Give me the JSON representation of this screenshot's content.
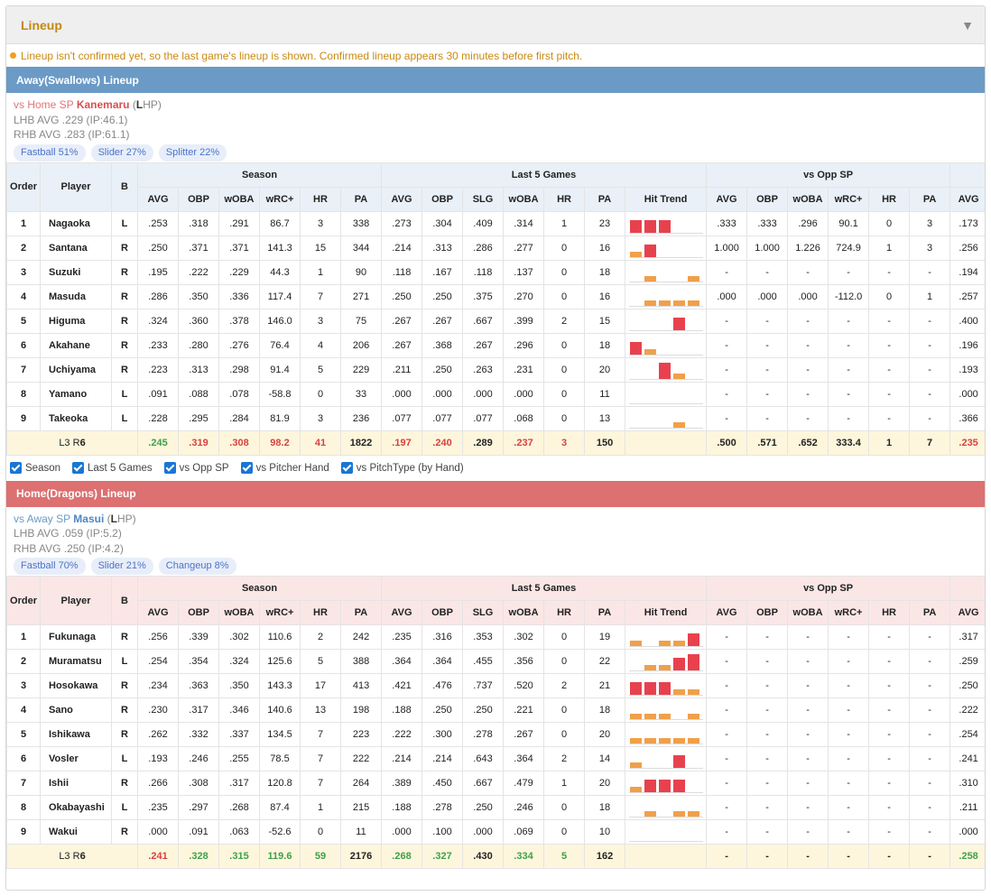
{
  "panel": {
    "title": "Lineup",
    "notice": "Lineup isn't confirmed yet, so the last game's lineup is shown. Confirmed lineup appears 30 minutes before first pitch."
  },
  "headers": {
    "order": "Order",
    "player": "Player",
    "bats": "B",
    "groups": [
      "Season",
      "Last 5 Games",
      "vs Opp SP"
    ],
    "season": [
      "AVG",
      "OBP",
      "wOBA",
      "wRC+",
      "HR",
      "PA"
    ],
    "last5": [
      "AVG",
      "OBP",
      "SLG",
      "wOBA",
      "HR",
      "PA",
      "Hit Trend"
    ],
    "opp": [
      "AVG",
      "OBP",
      "wOBA",
      "wRC+",
      "HR",
      "PA"
    ],
    "extra": "AVG"
  },
  "options": [
    "Season",
    "Last 5 Games",
    "vs Opp SP",
    "vs Pitcher Hand",
    "vs PitchType (by Hand)"
  ],
  "colors": {
    "away_bar": "#6b9ac6",
    "home_bar": "#dd7070",
    "trend_hit": "#e8414e",
    "trend_out": "#f0a04a",
    "summary_bg": "#fdf6dc"
  },
  "away": {
    "title": "Away(Swallows) Lineup",
    "sp_prefix": "vs Home SP",
    "sp_name": "Kanemaru",
    "sp_hand_open": "(",
    "sp_hand_letter": "L",
    "sp_hand_rest": "HP)",
    "lhb": "LHB AVG .229 (IP:46.1)",
    "rhb": "RHB AVG .283 (IP:61.1)",
    "pitches": [
      "Fastball 51%",
      "Slider 27%",
      "Splitter 22%"
    ],
    "rows": [
      {
        "o": "1",
        "n": "Nagaoka",
        "b": "L",
        "s": [
          ".253",
          ".318",
          ".291",
          "86.7",
          "3",
          "338"
        ],
        "l": [
          ".273",
          ".304",
          ".409",
          ".314",
          "1",
          "23"
        ],
        "t": [
          3,
          3,
          3,
          0,
          0
        ],
        "p": [
          ".333",
          ".333",
          ".296",
          "90.1",
          "0",
          "3"
        ],
        "x": ".173"
      },
      {
        "o": "2",
        "n": "Santana",
        "b": "R",
        "s": [
          ".250",
          ".371",
          ".371",
          "141.3",
          "15",
          "344"
        ],
        "l": [
          ".214",
          ".313",
          ".286",
          ".277",
          "0",
          "16"
        ],
        "t": [
          1,
          3,
          0,
          0,
          0
        ],
        "p": [
          "1.000",
          "1.000",
          "1.226",
          "724.9",
          "1",
          "3"
        ],
        "x": ".256"
      },
      {
        "o": "3",
        "n": "Suzuki",
        "b": "R",
        "s": [
          ".195",
          ".222",
          ".229",
          "44.3",
          "1",
          "90"
        ],
        "l": [
          ".118",
          ".167",
          ".118",
          ".137",
          "0",
          "18"
        ],
        "t": [
          0,
          1,
          0,
          0,
          1
        ],
        "p": [
          "-",
          "-",
          "-",
          "-",
          "-",
          "-"
        ],
        "x": ".194"
      },
      {
        "o": "4",
        "n": "Masuda",
        "b": "R",
        "s": [
          ".286",
          ".350",
          ".336",
          "117.4",
          "7",
          "271"
        ],
        "l": [
          ".250",
          ".250",
          ".375",
          ".270",
          "0",
          "16"
        ],
        "t": [
          0,
          1,
          1,
          1,
          1
        ],
        "p": [
          ".000",
          ".000",
          ".000",
          "-112.0",
          "0",
          "1"
        ],
        "x": ".257"
      },
      {
        "o": "5",
        "n": "Higuma",
        "b": "R",
        "s": [
          ".324",
          ".360",
          ".378",
          "146.0",
          "3",
          "75"
        ],
        "l": [
          ".267",
          ".267",
          ".667",
          ".399",
          "2",
          "15"
        ],
        "t": [
          0,
          0,
          0,
          3,
          0
        ],
        "p": [
          "-",
          "-",
          "-",
          "-",
          "-",
          "-"
        ],
        "x": ".400"
      },
      {
        "o": "6",
        "n": "Akahane",
        "b": "R",
        "s": [
          ".233",
          ".280",
          ".276",
          "76.4",
          "4",
          "206"
        ],
        "l": [
          ".267",
          ".368",
          ".267",
          ".296",
          "0",
          "18"
        ],
        "t": [
          3,
          1,
          0,
          0,
          0
        ],
        "p": [
          "-",
          "-",
          "-",
          "-",
          "-",
          "-"
        ],
        "x": ".196"
      },
      {
        "o": "7",
        "n": "Uchiyama",
        "b": "R",
        "s": [
          ".223",
          ".313",
          ".298",
          "91.4",
          "5",
          "229"
        ],
        "l": [
          ".211",
          ".250",
          ".263",
          ".231",
          "0",
          "20"
        ],
        "t": [
          0,
          0,
          4,
          1,
          0
        ],
        "p": [
          "-",
          "-",
          "-",
          "-",
          "-",
          "-"
        ],
        "x": ".193"
      },
      {
        "o": "8",
        "n": "Yamano",
        "b": "L",
        "s": [
          ".091",
          ".088",
          ".078",
          "-58.8",
          "0",
          "33"
        ],
        "l": [
          ".000",
          ".000",
          ".000",
          ".000",
          "0",
          "11"
        ],
        "t": [
          0,
          0,
          0,
          0,
          0
        ],
        "p": [
          "-",
          "-",
          "-",
          "-",
          "-",
          "-"
        ],
        "x": ".000"
      },
      {
        "o": "9",
        "n": "Takeoka",
        "b": "L",
        "s": [
          ".228",
          ".295",
          ".284",
          "81.9",
          "3",
          "236"
        ],
        "l": [
          ".077",
          ".077",
          ".077",
          ".068",
          "0",
          "13"
        ],
        "t": [
          0,
          0,
          0,
          1,
          0
        ],
        "p": [
          "-",
          "-",
          "-",
          "-",
          "-",
          "-"
        ],
        "x": ".366"
      }
    ],
    "summary": {
      "label": "L3 R",
      "label_b": "6",
      "s": [
        ".245",
        ".319",
        ".308",
        "98.2",
        "41",
        "1822"
      ],
      "sc": [
        "grn",
        "red",
        "red",
        "red",
        "red",
        ""
      ],
      "l": [
        ".197",
        ".240",
        ".289",
        ".237",
        "3",
        "150"
      ],
      "lc": [
        "red",
        "red",
        "",
        "red",
        "red",
        ""
      ],
      "p": [
        ".500",
        ".571",
        ".652",
        "333.4",
        "1",
        "7"
      ],
      "x": ".235",
      "xc": "red"
    }
  },
  "home": {
    "title": "Home(Dragons) Lineup",
    "sp_prefix": "vs Away SP",
    "sp_name": "Masui",
    "sp_hand_open": "(",
    "sp_hand_letter": "L",
    "sp_hand_rest": "HP)",
    "lhb": "LHB AVG .059 (IP:5.2)",
    "rhb": "RHB AVG .250 (IP:4.2)",
    "pitches": [
      "Fastball 70%",
      "Slider 21%",
      "Changeup 8%"
    ],
    "rows": [
      {
        "o": "1",
        "n": "Fukunaga",
        "b": "R",
        "s": [
          ".256",
          ".339",
          ".302",
          "110.6",
          "2",
          "242"
        ],
        "l": [
          ".235",
          ".316",
          ".353",
          ".302",
          "0",
          "19"
        ],
        "t": [
          1,
          0,
          1,
          1,
          3
        ],
        "p": [
          "-",
          "-",
          "-",
          "-",
          "-",
          "-"
        ],
        "x": ".317"
      },
      {
        "o": "2",
        "n": "Muramatsu",
        "b": "L",
        "s": [
          ".254",
          ".354",
          ".324",
          "125.6",
          "5",
          "388"
        ],
        "l": [
          ".364",
          ".364",
          ".455",
          ".356",
          "0",
          "22"
        ],
        "t": [
          0,
          1,
          1,
          3,
          4
        ],
        "p": [
          "-",
          "-",
          "-",
          "-",
          "-",
          "-"
        ],
        "x": ".259"
      },
      {
        "o": "3",
        "n": "Hosokawa",
        "b": "R",
        "s": [
          ".234",
          ".363",
          ".350",
          "143.3",
          "17",
          "413"
        ],
        "l": [
          ".421",
          ".476",
          ".737",
          ".520",
          "2",
          "21"
        ],
        "t": [
          3,
          3,
          3,
          1,
          1
        ],
        "p": [
          "-",
          "-",
          "-",
          "-",
          "-",
          "-"
        ],
        "x": ".250"
      },
      {
        "o": "4",
        "n": "Sano",
        "b": "R",
        "s": [
          ".230",
          ".317",
          ".346",
          "140.6",
          "13",
          "198"
        ],
        "l": [
          ".188",
          ".250",
          ".250",
          ".221",
          "0",
          "18"
        ],
        "t": [
          1,
          1,
          1,
          0,
          1
        ],
        "p": [
          "-",
          "-",
          "-",
          "-",
          "-",
          "-"
        ],
        "x": ".222"
      },
      {
        "o": "5",
        "n": "Ishikawa",
        "b": "R",
        "s": [
          ".262",
          ".332",
          ".337",
          "134.5",
          "7",
          "223"
        ],
        "l": [
          ".222",
          ".300",
          ".278",
          ".267",
          "0",
          "20"
        ],
        "t": [
          1,
          1,
          1,
          1,
          1
        ],
        "p": [
          "-",
          "-",
          "-",
          "-",
          "-",
          "-"
        ],
        "x": ".254"
      },
      {
        "o": "6",
        "n": "Vosler",
        "b": "L",
        "s": [
          ".193",
          ".246",
          ".255",
          "78.5",
          "7",
          "222"
        ],
        "l": [
          ".214",
          ".214",
          ".643",
          ".364",
          "2",
          "14"
        ],
        "t": [
          1,
          0,
          0,
          3,
          0
        ],
        "p": [
          "-",
          "-",
          "-",
          "-",
          "-",
          "-"
        ],
        "x": ".241"
      },
      {
        "o": "7",
        "n": "Ishii",
        "b": "R",
        "s": [
          ".266",
          ".308",
          ".317",
          "120.8",
          "7",
          "264"
        ],
        "l": [
          ".389",
          ".450",
          ".667",
          ".479",
          "1",
          "20"
        ],
        "t": [
          1,
          3,
          3,
          3,
          0
        ],
        "p": [
          "-",
          "-",
          "-",
          "-",
          "-",
          "-"
        ],
        "x": ".310"
      },
      {
        "o": "8",
        "n": "Okabayashi",
        "b": "L",
        "s": [
          ".235",
          ".297",
          ".268",
          "87.4",
          "1",
          "215"
        ],
        "l": [
          ".188",
          ".278",
          ".250",
          ".246",
          "0",
          "18"
        ],
        "t": [
          0,
          1,
          0,
          1,
          1
        ],
        "p": [
          "-",
          "-",
          "-",
          "-",
          "-",
          "-"
        ],
        "x": ".211"
      },
      {
        "o": "9",
        "n": "Wakui",
        "b": "R",
        "s": [
          ".000",
          ".091",
          ".063",
          "-52.6",
          "0",
          "11"
        ],
        "l": [
          ".000",
          ".100",
          ".000",
          ".069",
          "0",
          "10"
        ],
        "t": [
          0,
          0,
          0,
          0,
          0
        ],
        "p": [
          "-",
          "-",
          "-",
          "-",
          "-",
          "-"
        ],
        "x": ".000"
      }
    ],
    "summary": {
      "label": "L3 R",
      "label_b": "6",
      "s": [
        ".241",
        ".328",
        ".315",
        "119.6",
        "59",
        "2176"
      ],
      "sc": [
        "red",
        "grn",
        "grn",
        "grn",
        "grn",
        ""
      ],
      "l": [
        ".268",
        ".327",
        ".430",
        ".334",
        "5",
        "162"
      ],
      "lc": [
        "grn",
        "grn",
        "",
        "grn",
        "grn",
        ""
      ],
      "p": [
        "-",
        "-",
        "-",
        "-",
        "-",
        "-"
      ],
      "x": ".258",
      "xc": "grn"
    }
  }
}
